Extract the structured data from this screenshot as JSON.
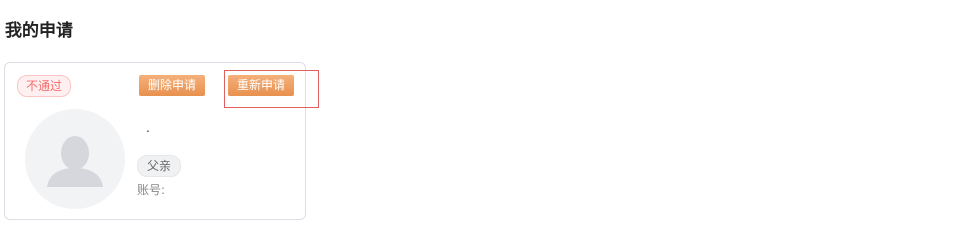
{
  "page": {
    "title": "我的申请"
  },
  "card": {
    "status": "不通过",
    "delete_button": "删除申请",
    "reapply_button": "重新申请",
    "name": ".",
    "relation": "父亲",
    "account_label": "账号:",
    "avatar_icon": "user-silhouette-icon",
    "colors": {
      "status_text": "#f56c6c",
      "status_bg": "#fef0f0",
      "button_accent": "#e8914f",
      "highlight_border": "#e06060"
    }
  }
}
